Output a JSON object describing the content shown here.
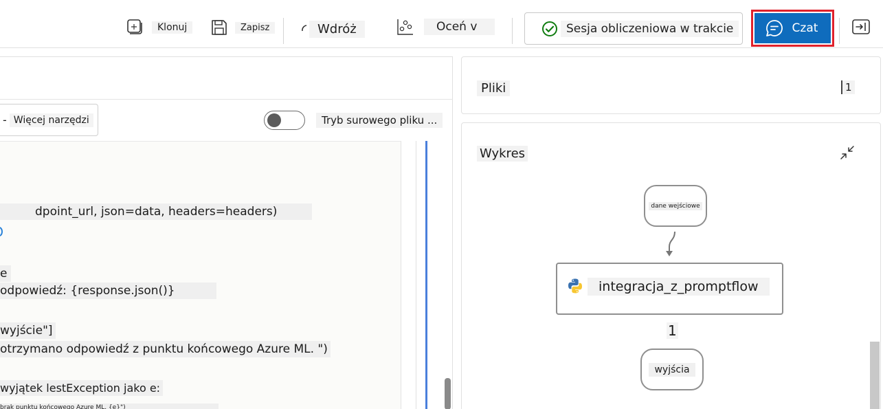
{
  "toolbar": {
    "clone_label": "Klonuj",
    "save_label": "Zapisz",
    "deploy_label": "Wdróż",
    "evaluate_label": "Oceń v",
    "status_text": "Sesja obliczeniowa w trakcie",
    "chat_label": "Czat"
  },
  "left_panel": {
    "more_tools_label": "Więcej narzędzi",
    "raw_mode_label": "Tryb surowego pliku ...",
    "code_lines": [
      "dpoint_url, json=data, headers=headers)",
      "e",
      "odpowiedź: {response.json()}",
      " wyjście\"]",
      "otrzymano odpowiedź z punktu końcowego Azure ML. \")",
      "wyjątek lestException jako e:",
      "brak punktu końcowego Azure ML. {e}\")"
    ]
  },
  "files_panel": {
    "title": "Pliki",
    "count": "1"
  },
  "graph_panel": {
    "title": "Wykres",
    "input_node": "dane wejściowe",
    "main_node": "integracja_z_promptflow",
    "edge_count": "1",
    "output_node": "wyjścia"
  },
  "colors": {
    "accent": "#0f6cbd",
    "highlight_border": "#e0212b",
    "status_ok": "#107c10"
  }
}
